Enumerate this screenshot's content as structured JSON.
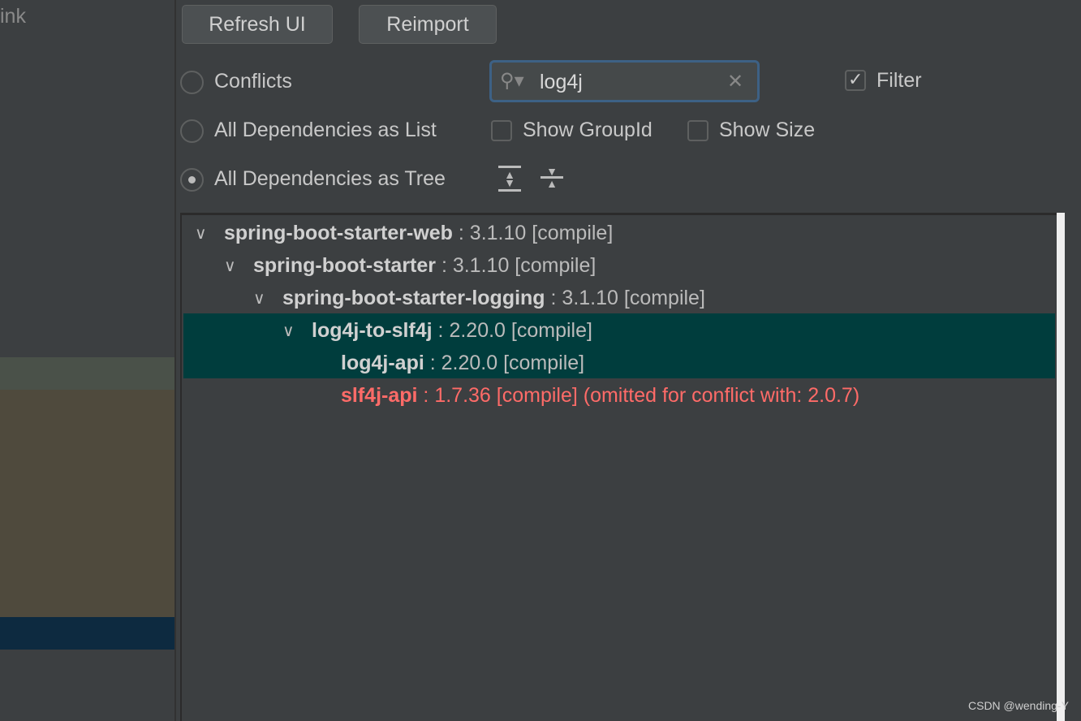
{
  "left_panel": {
    "label": "ink",
    "bands": {
      "green": "#4a5149",
      "brown": "#4f4a3d",
      "navy": "#0d2a40"
    }
  },
  "toolbar": {
    "refresh": "Refresh UI",
    "reimport": "Reimport"
  },
  "modes": [
    {
      "label": "Conflicts",
      "selected": false
    },
    {
      "label": "All Dependencies as List",
      "selected": false
    },
    {
      "label": "All Dependencies as Tree",
      "selected": true
    }
  ],
  "search": {
    "value": "log4j",
    "icon": "search-icon"
  },
  "options": {
    "filter": {
      "label": "Filter",
      "checked": true
    },
    "show_group_id": {
      "label": "Show GroupId",
      "checked": false
    },
    "show_size": {
      "label": "Show Size",
      "checked": false
    }
  },
  "tree": [
    {
      "name": "spring-boot-starter-web",
      "detail": " : 3.1.10 [compile]",
      "level": 0,
      "expanded": true
    },
    {
      "name": "spring-boot-starter",
      "detail": " : 3.1.10 [compile]",
      "level": 1,
      "expanded": true
    },
    {
      "name": "spring-boot-starter-logging",
      "detail": " : 3.1.10 [compile]",
      "level": 2,
      "expanded": true
    },
    {
      "name": "log4j-to-slf4j",
      "detail": " : 2.20.0 [compile]",
      "level": 3,
      "expanded": true,
      "selected": true
    },
    {
      "name": "log4j-api",
      "detail": " : 2.20.0 [compile]",
      "level": 4,
      "selected": true
    },
    {
      "name": "slf4j-api",
      "detail": " : 1.7.36 [compile] (omitted for conflict with: 2.0.7)",
      "level": 4,
      "conflict": true
    }
  ],
  "watermark": "CSDN @wending-Y",
  "colors": {
    "selection": "#003d3d",
    "conflict": "#ff6b68"
  }
}
